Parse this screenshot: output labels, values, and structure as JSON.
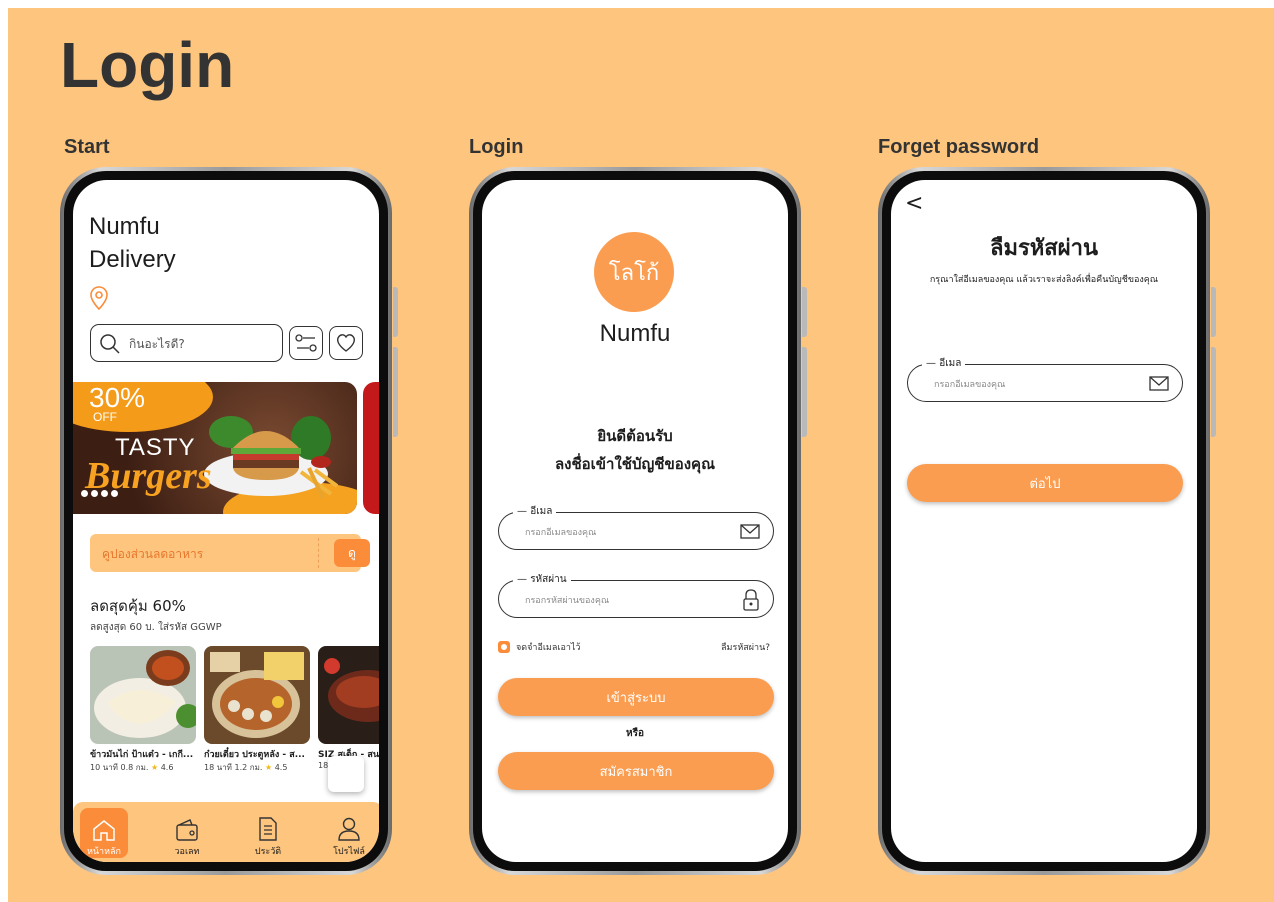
{
  "page": {
    "title": "Login"
  },
  "sections": {
    "start": "Start",
    "login": "Login",
    "forget": "Forget password"
  },
  "colors": {
    "background": "#fec57e",
    "accent": "#fb9d50",
    "accent_dark": "#fb8c3a"
  },
  "start": {
    "app_name_line1": "Numfu",
    "app_name_line2": "Delivery",
    "search_placeholder": "กินอะไรดี?",
    "banner": {
      "discount": "30%",
      "off": "OFF",
      "tasty": "TASTY",
      "burgers": "Burgers"
    },
    "coupon": {
      "label": "คูปองส่วนลดอาหาร",
      "button": "ดู"
    },
    "deal": {
      "title": "ลดสุดคุ้ม 60%",
      "subtitle": "ลดสูงสุด 60 บ. ใส่รหัส GGWP"
    },
    "foods": [
      {
        "name": "ข้าวมันไก่ ป้าแต๋ว - เกกี...",
        "meta": "10 นาที 0.8 กม.",
        "rating": "4.6"
      },
      {
        "name": "ก๋วยเตี๋ยว ประตูหลัง - ส...",
        "meta": "18 นาที 1.2 กม.",
        "rating": "4.5"
      },
      {
        "name": "SIZ สเต็ก - สน",
        "meta": "18",
        "rating": ""
      }
    ],
    "tabs": [
      {
        "label": "หน้าหลัก",
        "icon": "home-icon"
      },
      {
        "label": "วอเลท",
        "icon": "wallet-icon"
      },
      {
        "label": "ประวัติ",
        "icon": "document-icon"
      },
      {
        "label": "โปรไฟล์",
        "icon": "user-icon"
      }
    ]
  },
  "login": {
    "logo_text": "โลโก้",
    "brand": "Numfu",
    "welcome_line1": "ยินดีต้อนรับ",
    "welcome_line2": "ลงชื่อเข้าใช้บัญชีของคุณ",
    "email_label": "อีเมล",
    "email_placeholder": "กรอกอีเมลของคุณ",
    "password_label": "รหัสผ่าน",
    "password_placeholder": "กรอกรหัสผ่านของคุณ",
    "remember": "จดจำอีเมลเอาไว้",
    "forgot": "ลืมรหัสผ่าน?",
    "login_button": "เข้าสู่ระบบ",
    "or": "หรือ",
    "register_button": "สมัครสมาชิก"
  },
  "forget": {
    "back": "<",
    "title": "ลืมรหัสผ่าน",
    "subtitle": "กรุณาใส่อีเมลของคุณ แล้วเราจะส่งลิงค์เพื่อคืนบัญชีของคุณ",
    "email_label": "อีเมล",
    "email_placeholder": "กรอกอีเมลของคุณ",
    "next_button": "ต่อไป"
  }
}
